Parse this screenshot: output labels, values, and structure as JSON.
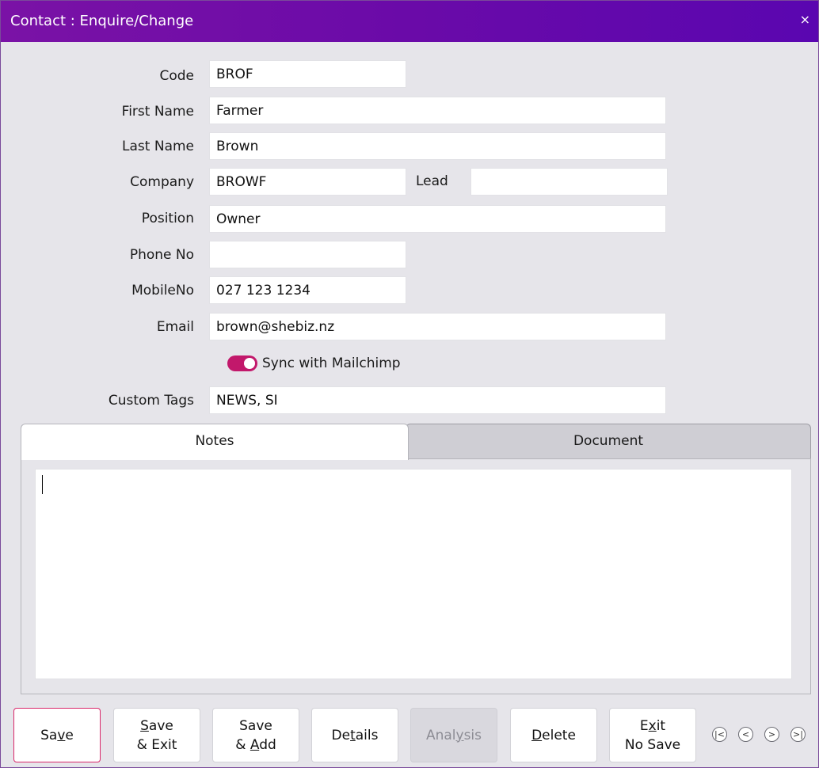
{
  "window": {
    "title": "Contact : Enquire/Change",
    "close_glyph": "×"
  },
  "form": {
    "code": {
      "label": "Code",
      "value": "BROF"
    },
    "first_name": {
      "label": "First Name",
      "value": "Farmer"
    },
    "last_name": {
      "label": "Last Name",
      "value": "Brown"
    },
    "company": {
      "label": "Company",
      "value": "BROWF"
    },
    "lead": {
      "label": "Lead",
      "value": ""
    },
    "position": {
      "label": "Position",
      "value": "Owner"
    },
    "phone": {
      "label": "Phone No",
      "value": ""
    },
    "mobile": {
      "label": "MobileNo",
      "value": "027 123 1234"
    },
    "email": {
      "label": "Email",
      "value": "brown@shebiz.nz"
    },
    "sync": {
      "label": "Sync with Mailchimp",
      "on": true
    },
    "custom_tags": {
      "label": "Custom Tags",
      "value": "NEWS, SI"
    }
  },
  "tabs": [
    {
      "label": "Notes",
      "active": true
    },
    {
      "label": "Document",
      "active": false
    }
  ],
  "notes": {
    "value": ""
  },
  "buttons": [
    {
      "pre": "Sa",
      "ul": "v",
      "post": "e",
      "line2": ""
    },
    {
      "pre": "",
      "ul": "S",
      "post": "ave",
      "line2": "& Exit"
    },
    {
      "pre": "Save",
      "ul": "",
      "post": "",
      "line2_pre": "& ",
      "line2_ul": "A",
      "line2_post": "dd"
    },
    {
      "pre": "De",
      "ul": "t",
      "post": "ails",
      "line2": ""
    },
    {
      "pre": "Anal",
      "ul": "y",
      "post": "sis",
      "line2": ""
    },
    {
      "pre": "",
      "ul": "D",
      "post": "elete",
      "line2": ""
    },
    {
      "pre": "E",
      "ul": "x",
      "post": "it",
      "line2": "No Save"
    }
  ],
  "nav": [
    "|<",
    "<",
    ">",
    ">|"
  ],
  "colors": {
    "titlebar": "#6a0aa8",
    "toggle": "#c2186b",
    "primary_border": "#d9276a"
  }
}
